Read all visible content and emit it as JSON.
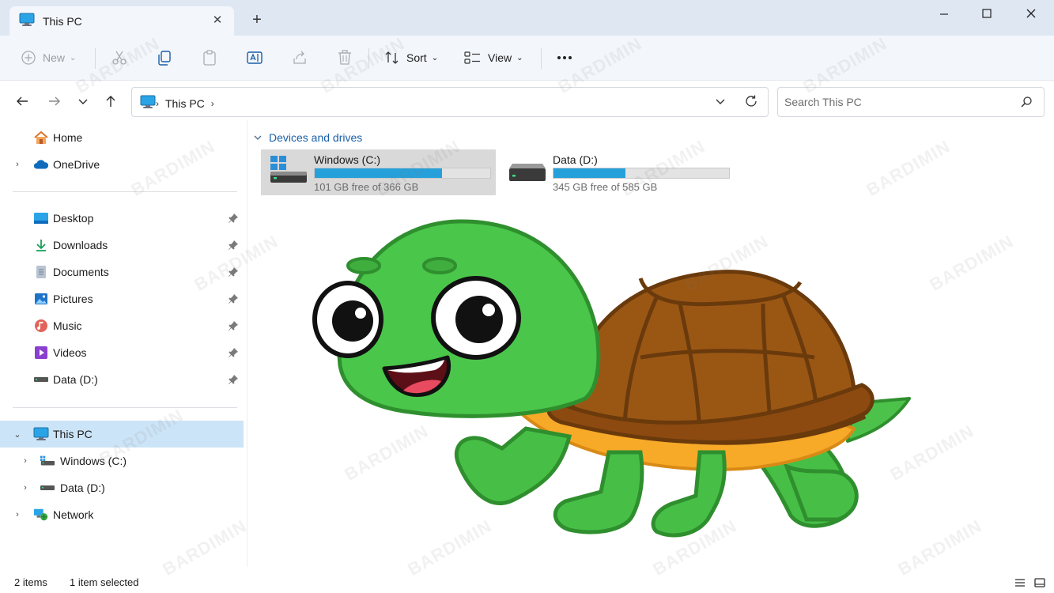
{
  "window": {
    "tab_title": "This PC",
    "tab_icon": "monitor-icon"
  },
  "toolbar": {
    "new_label": "New",
    "sort_label": "Sort",
    "view_label": "View"
  },
  "address": {
    "location": "This PC"
  },
  "search": {
    "placeholder": "Search This PC"
  },
  "sidebar": {
    "top": [
      {
        "label": "Home",
        "icon": "home-icon"
      },
      {
        "label": "OneDrive",
        "icon": "cloud-icon"
      }
    ],
    "quick_access": [
      {
        "label": "Desktop",
        "icon": "desktop-icon"
      },
      {
        "label": "Downloads",
        "icon": "download-icon"
      },
      {
        "label": "Documents",
        "icon": "document-icon"
      },
      {
        "label": "Pictures",
        "icon": "pictures-icon"
      },
      {
        "label": "Music",
        "icon": "music-icon"
      },
      {
        "label": "Videos",
        "icon": "videos-icon"
      },
      {
        "label": "Data (D:)",
        "icon": "drive-icon"
      }
    ],
    "this_pc": {
      "label": "This PC",
      "icon": "monitor-icon"
    },
    "drives": [
      {
        "label": "Windows  (C:)",
        "icon": "windows-drive-icon"
      },
      {
        "label": "Data (D:)",
        "icon": "drive-icon"
      }
    ],
    "network": {
      "label": "Network",
      "icon": "network-icon"
    }
  },
  "main": {
    "group_label": "Devices and drives",
    "drives": [
      {
        "name": "Windows  (C:)",
        "free_text": "101 GB free of 366 GB",
        "used_fraction": 0.724
      },
      {
        "name": "Data (D:)",
        "free_text": "345 GB free of 585 GB",
        "used_fraction": 0.41
      }
    ]
  },
  "statusbar": {
    "items_count": "2 items",
    "selection": "1 item selected"
  },
  "watermark": "BARDIMIN",
  "colors": {
    "accent": "#26a0da",
    "selection": "#cce4f7",
    "titlebar": "#dfe7f3"
  }
}
